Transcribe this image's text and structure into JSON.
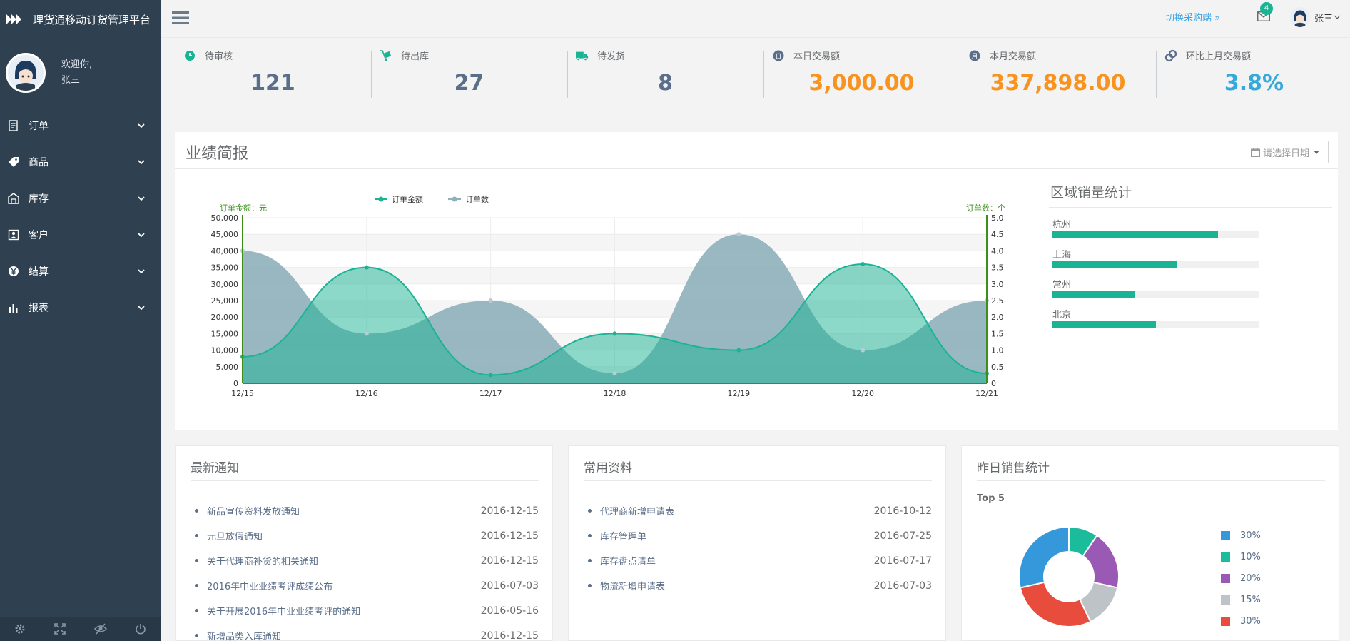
{
  "app": {
    "title": "理货通移动订货管理平台"
  },
  "profile": {
    "welcome": "欢迎你,",
    "name": "张三"
  },
  "sidebar": {
    "items": [
      {
        "label": "订单",
        "icon": "order-icon"
      },
      {
        "label": "商品",
        "icon": "tag-icon"
      },
      {
        "label": "库存",
        "icon": "warehouse-icon"
      },
      {
        "label": "客户",
        "icon": "customer-icon"
      },
      {
        "label": "结算",
        "icon": "yen-icon"
      },
      {
        "label": "报表",
        "icon": "bar-chart-icon"
      }
    ],
    "footer_icons": [
      "gear-icon",
      "fullscreen-icon",
      "eye-slash-icon",
      "power-icon"
    ]
  },
  "topbar": {
    "switch_label": "切换采购端 »",
    "mail_count": "4",
    "user_name": "张三"
  },
  "stats": [
    {
      "label": "待审核",
      "value": "121",
      "icon": "clock-icon",
      "color": "#5a6e8a"
    },
    {
      "label": "待出库",
      "value": "27",
      "icon": "dolly-icon",
      "color": "#5a6e8a"
    },
    {
      "label": "待发货",
      "value": "8",
      "icon": "truck-icon",
      "color": "#5a6e8a"
    },
    {
      "label": "本日交易额",
      "value": "3,000.00",
      "icon": "calendar-day-icon",
      "color": "#f7931e"
    },
    {
      "label": "本月交易额",
      "value": "337,898.00",
      "icon": "calendar-month-icon",
      "color": "#f7931e"
    },
    {
      "label": "环比上月交易额",
      "value": "3.8%",
      "icon": "link-icon",
      "color": "#35a9dc"
    }
  ],
  "performance": {
    "title": "业绩简报",
    "date_placeholder": "请选择日期"
  },
  "chart_data": {
    "type": "area",
    "categories": [
      "12/15",
      "12/16",
      "12/17",
      "12/18",
      "12/19",
      "12/20",
      "12/21"
    ],
    "series": [
      {
        "name": "订单金额",
        "axis": "left",
        "color": "#1ab394",
        "values": [
          8000,
          35000,
          2500,
          15000,
          10000,
          36000,
          3000
        ]
      },
      {
        "name": "订单数",
        "axis": "right",
        "color": "#8fb0bb",
        "values": [
          4.0,
          1.5,
          2.5,
          0.3,
          4.5,
          1.0,
          2.5
        ]
      }
    ],
    "y_left": {
      "label": "订单金额：元",
      "ticks": [
        "50,000",
        "45,000",
        "40,000",
        "35,000",
        "30,000",
        "25,000",
        "20,000",
        "15,000",
        "10,000",
        "5,000",
        "0"
      ],
      "ylim": [
        0,
        50000
      ]
    },
    "y_right": {
      "label": "订单数：个",
      "ticks": [
        "5.0",
        "4.5",
        "4.0",
        "3.5",
        "3.0",
        "2.5",
        "2.0",
        "1.5",
        "1.0",
        "0.5",
        "0"
      ],
      "ylim": [
        0,
        5
      ]
    },
    "legend_position": "top-center",
    "grid": true
  },
  "region": {
    "title": "区域销量统计",
    "items": [
      {
        "label": "杭州",
        "value": 0.8
      },
      {
        "label": "上海",
        "value": 0.6
      },
      {
        "label": "常州",
        "value": 0.4
      },
      {
        "label": "北京",
        "value": 0.5
      }
    ]
  },
  "notices": {
    "title": "最新通知",
    "items": [
      {
        "text": "新品宣传资料发放通知",
        "date": "2016-12-15"
      },
      {
        "text": "元旦放假通知",
        "date": "2016-12-15"
      },
      {
        "text": "关于代理商补货的相关通知",
        "date": "2016-12-15"
      },
      {
        "text": "2016年中业业绩考评成绩公布",
        "date": "2016-07-03"
      },
      {
        "text": "关于开展2016年中业业绩考评的通知",
        "date": "2016-05-16"
      },
      {
        "text": "新增品类入库通知",
        "date": "2016-12-15"
      }
    ]
  },
  "resources": {
    "title": "常用资料",
    "items": [
      {
        "text": "代理商新增申请表",
        "date": "2016-10-12"
      },
      {
        "text": "库存管理单",
        "date": "2016-07-25"
      },
      {
        "text": "库存盘点清单",
        "date": "2016-07-17"
      },
      {
        "text": "物流新增申请表",
        "date": "2016-07-03"
      }
    ]
  },
  "yesterday": {
    "title": "昨日销售统计",
    "subtitle": "Top 5",
    "slices": [
      {
        "label": "30%",
        "value": 30,
        "color": "#3498db"
      },
      {
        "label": "10%",
        "value": 10,
        "color": "#1abc9c"
      },
      {
        "label": "20%",
        "value": 20,
        "color": "#9b59b6"
      },
      {
        "label": "15%",
        "value": 15,
        "color": "#bdc3c7"
      },
      {
        "label": "30%",
        "value": 30,
        "color": "#e74c3c"
      }
    ]
  }
}
